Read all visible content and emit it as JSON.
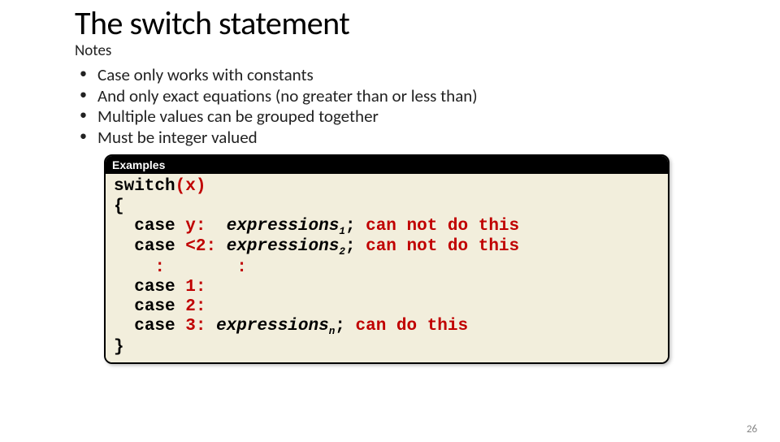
{
  "title": "The switch statement",
  "subtitle": "Notes",
  "bullets": [
    "Case only works with constants",
    "And only exact equations (no greater than or less than)",
    "Multiple values can be grouped together",
    "Must be integer valued"
  ],
  "code": {
    "header": "Examples",
    "kw_switch": "switch",
    "paren_open": "(",
    "var_x": "x",
    "paren_close": ")",
    "brace_open": "{",
    "kw_case": "case",
    "val_y": "y",
    "val_lt2": "<2",
    "val_1": "1",
    "val_2": "2",
    "val_3": "3",
    "colon": ":",
    "expr_word": "expressions",
    "sub_1": "1",
    "sub_2": "2",
    "sub_n": "n",
    "semicolon": ";",
    "note_cannot": "can not do this",
    "note_can": "can do this",
    "vdots": ":",
    "brace_close": "}"
  },
  "page_number": "26"
}
